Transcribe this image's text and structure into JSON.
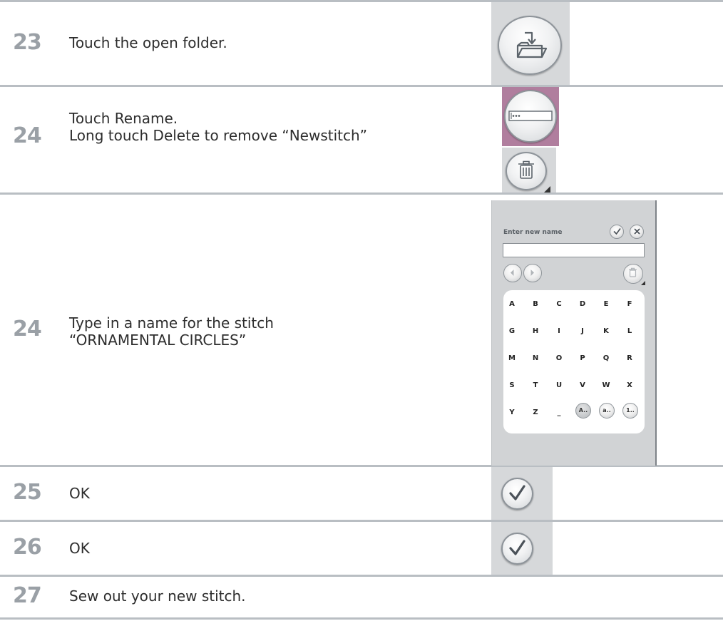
{
  "steps": [
    {
      "number": "23",
      "lines": [
        "Touch the open folder."
      ]
    },
    {
      "number": "24",
      "lines": [
        "Touch Rename.",
        "Long touch Delete to remove “Newstitch”"
      ]
    },
    {
      "number": "24",
      "lines": [
        "Type in a name for the stitch",
        "“ORNAMENTAL CIRCLES”"
      ]
    },
    {
      "number": "25",
      "lines": [
        "OK"
      ]
    },
    {
      "number": "26",
      "lines": [
        "OK"
      ]
    },
    {
      "number": "27",
      "lines": [
        "Sew out your new stitch."
      ]
    }
  ],
  "rename_panel": {
    "label": "Enter new name",
    "input_value": "",
    "keys": [
      [
        "A",
        "B",
        "C",
        "D",
        "E",
        "F"
      ],
      [
        "G",
        "H",
        "I",
        "J",
        "K",
        "L"
      ],
      [
        "M",
        "N",
        "O",
        "P",
        "Q",
        "R"
      ],
      [
        "S",
        "T",
        "U",
        "V",
        "W",
        "X"
      ],
      [
        "Y",
        "Z",
        "_"
      ]
    ],
    "mode_buttons": [
      "A..",
      "a..",
      "1.."
    ]
  },
  "icons": {
    "open_folder": "open-folder-icon",
    "rename": "rename-icon",
    "delete": "trash-icon",
    "ok": "checkmark-icon",
    "cancel": "close-icon"
  },
  "colors": {
    "rule": "#b9bec3",
    "step_number": "#9aa0a6",
    "thumb_bg": "#d6d8da",
    "rename_highlight": "#b07e9e"
  }
}
